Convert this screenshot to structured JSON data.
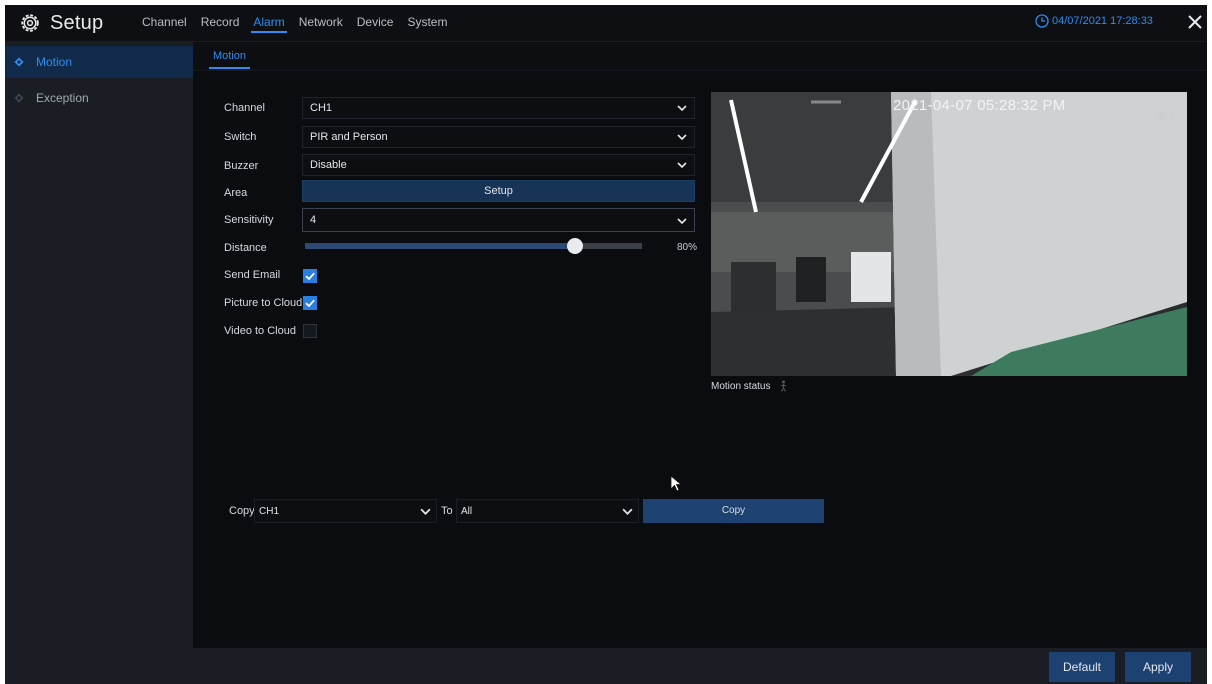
{
  "app": {
    "title": "Setup"
  },
  "nav": {
    "tabs": [
      {
        "label": "Channel"
      },
      {
        "label": "Record"
      },
      {
        "label": "Alarm",
        "active": true
      },
      {
        "label": "Network"
      },
      {
        "label": "Device"
      },
      {
        "label": "System"
      }
    ]
  },
  "clock": {
    "datetime": "04/07/2021 17:28:33"
  },
  "sidebar": {
    "items": [
      {
        "label": "Motion",
        "active": true
      },
      {
        "label": "Exception"
      }
    ]
  },
  "subtab": {
    "label": "Motion"
  },
  "form": {
    "channel": {
      "label": "Channel",
      "value": "CH1"
    },
    "switch": {
      "label": "Switch",
      "value": "PIR and Person"
    },
    "buzzer": {
      "label": "Buzzer",
      "value": "Disable"
    },
    "area": {
      "label": "Area",
      "button": "Setup"
    },
    "sensitivity": {
      "label": "Sensitivity",
      "value": "4"
    },
    "distance": {
      "label": "Distance",
      "value_text": "80%",
      "fraction": 0.8
    },
    "send_email": {
      "label": "Send Email",
      "checked": true
    },
    "picture_to_cloud": {
      "label": "Picture to Cloud",
      "checked": true
    },
    "video_to_cloud": {
      "label": "Video to Cloud",
      "checked": false
    }
  },
  "preview": {
    "osd_time": "2021-04-07 05:28:32 PM",
    "motion_status_label": "Motion status"
  },
  "copy": {
    "label": "Copy",
    "from_value": "CH1",
    "to_label": "To",
    "to_value": "All",
    "button": "Copy"
  },
  "footer": {
    "default_label": "Default",
    "apply_label": "Apply"
  },
  "colors": {
    "accent": "#2f8cf0",
    "button": "#1d4170",
    "sidebar_bg": "#1a1d24",
    "background": "#0a0c0f"
  }
}
